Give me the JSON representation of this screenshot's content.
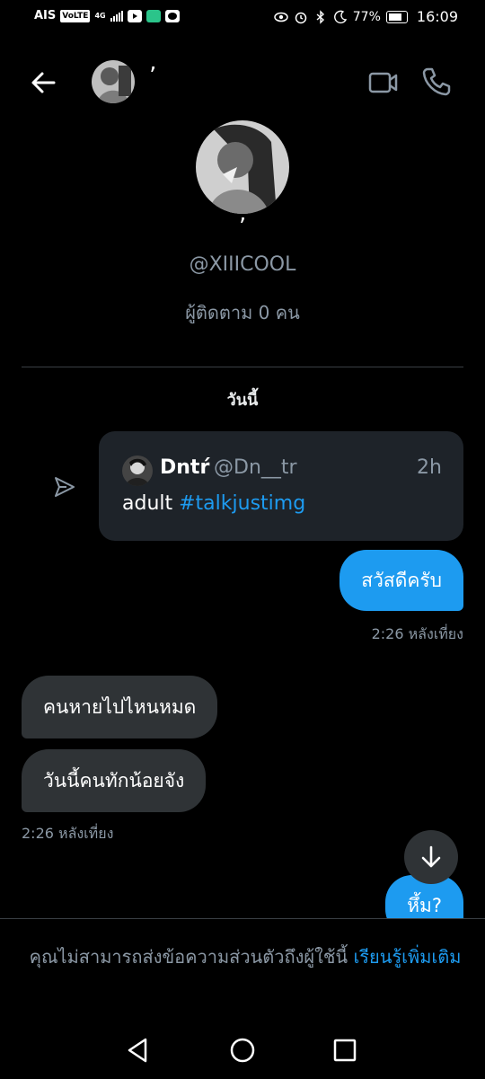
{
  "status_bar": {
    "carrier": "AIS",
    "volte": "VoLTE",
    "network": "4G",
    "battery": "77%",
    "time": "16:09"
  },
  "header": {
    "name": "’"
  },
  "profile": {
    "name": "’",
    "handle": "@XIIICOOL",
    "followers": "ผู้ติดตาม 0 คน"
  },
  "day_label": "วันนี้",
  "tweet": {
    "name": "Dntŕ",
    "handle": "@Dn__tr",
    "time": "2h",
    "text": "adult ",
    "hashtag": "#talkjustimg"
  },
  "messages": [
    {
      "direction": "out",
      "text": "สวัสดีครับ"
    },
    {
      "direction": "time-out",
      "text": "2:26 หลังเที่ยง"
    },
    {
      "direction": "in",
      "text": "คนหายไปไหนหมด"
    },
    {
      "direction": "in",
      "text": "วันนี้คนทักน้อยจัง"
    },
    {
      "direction": "time-in",
      "text": "2:26 หลังเที่ยง"
    },
    {
      "direction": "out",
      "text": "หึ้ม?"
    }
  ],
  "notice": {
    "text": "คุณไม่สามารถส่งข้อความส่วนตัวถึงผู้ใช้นี้ ",
    "link": "เรียนรู้เพิ่มเติม"
  },
  "colors": {
    "background": "#000000",
    "accent": "#1d9bf0",
    "incoming_bubble": "#2f3336",
    "card": "#1e2329",
    "secondary_text": "#8b98a5"
  },
  "icons": [
    "back-arrow-icon",
    "video-call-icon",
    "phone-icon",
    "share-icon",
    "arrow-down-icon",
    "nav-back-icon",
    "nav-home-icon",
    "nav-recents-icon"
  ]
}
